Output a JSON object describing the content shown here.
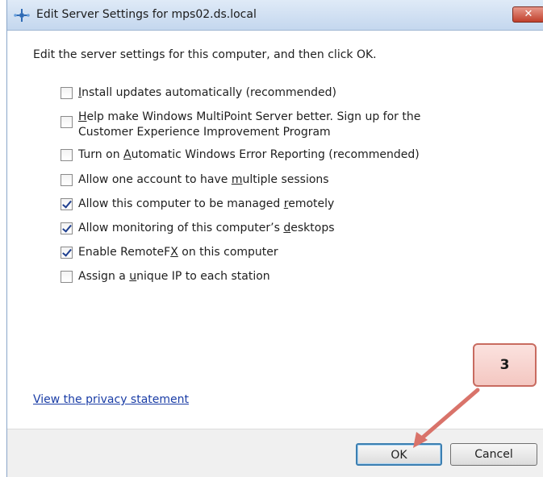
{
  "window": {
    "title": "Edit Server Settings for mps02.ds.local",
    "close_label": "✕"
  },
  "instruction": "Edit the server settings for this computer, and then click OK.",
  "options": [
    {
      "pre": "",
      "key": "I",
      "post": "nstall updates automatically (recommended)",
      "checked": false
    },
    {
      "pre": "",
      "key": "H",
      "post": "elp make Windows MultiPoint Server better. Sign up for the",
      "line2": "Customer Experience Improvement Program",
      "checked": false
    },
    {
      "pre": "Turn on ",
      "key": "A",
      "post": "utomatic Windows Error Reporting (recommended)",
      "checked": false
    },
    {
      "pre": "Allow one account to have ",
      "key": "m",
      "post": "ultiple sessions",
      "checked": false
    },
    {
      "pre": "Allow this computer to be managed ",
      "key": "r",
      "post": "emotely",
      "checked": true
    },
    {
      "pre": "Allow monitoring of this computer’s ",
      "key": "d",
      "post": "esktops",
      "checked": true
    },
    {
      "pre": "Enable RemoteF",
      "key": "X",
      "post": " on this computer",
      "checked": true
    },
    {
      "pre": "Assign a ",
      "key": "u",
      "post": "nique IP to each station",
      "checked": false
    }
  ],
  "privacy_link": "View the privacy statement",
  "buttons": {
    "ok": "OK",
    "cancel": "Cancel"
  },
  "callout": {
    "label": "3",
    "arrow_color": "#d9736a"
  }
}
